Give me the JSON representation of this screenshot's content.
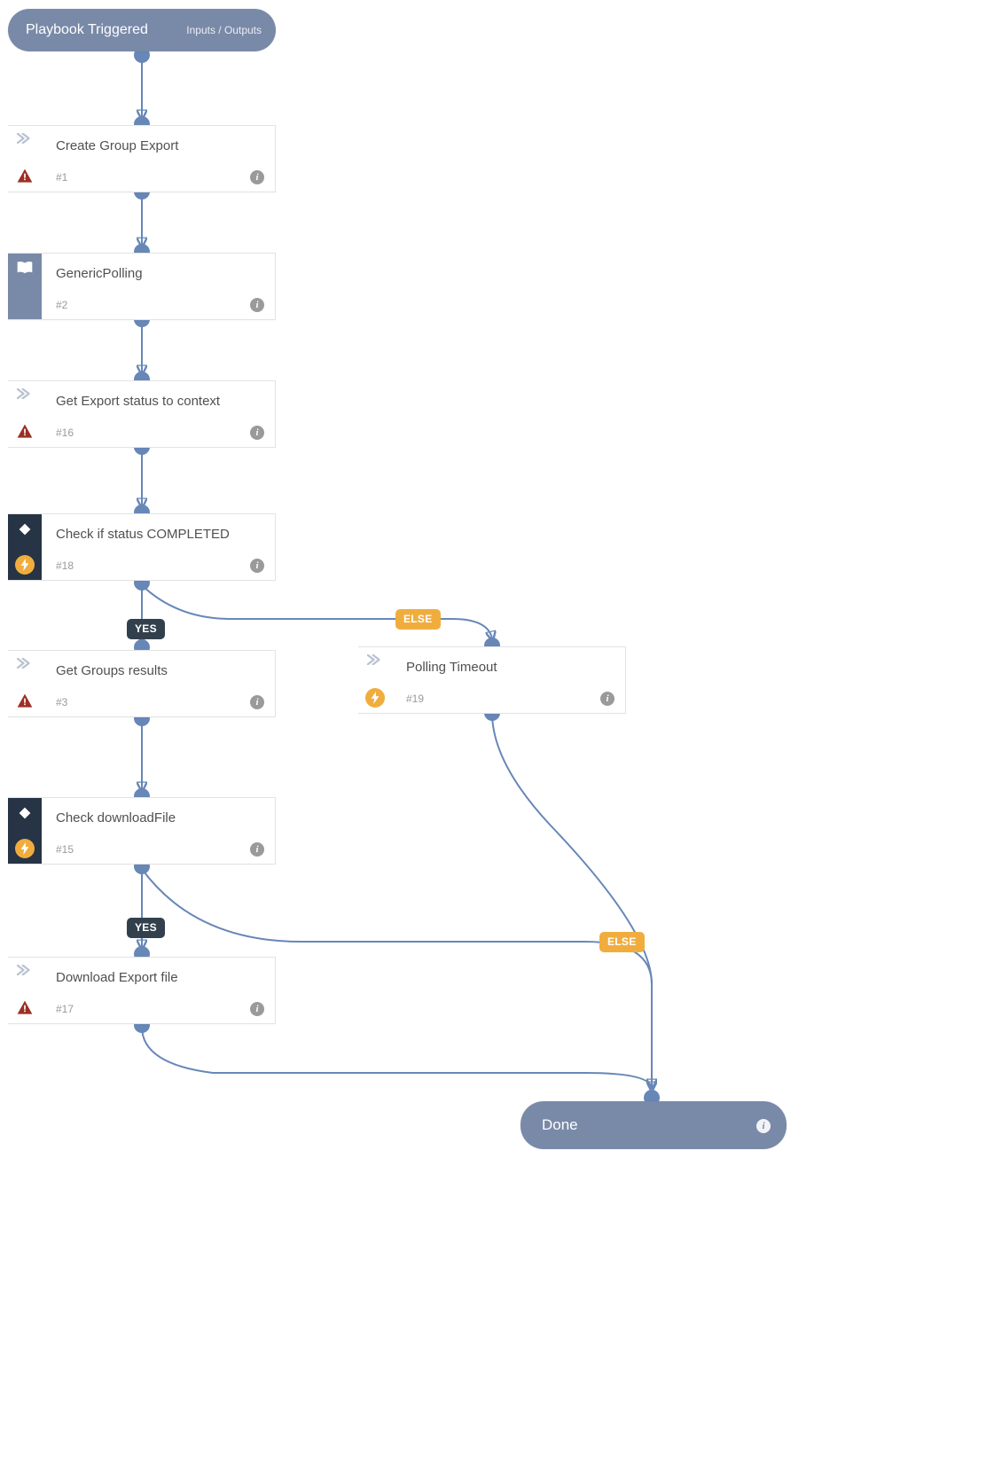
{
  "trigger": {
    "title": "Playbook Triggered",
    "io_label": "Inputs / Outputs"
  },
  "done": {
    "title": "Done"
  },
  "nodes": {
    "n1": {
      "title": "Create Group Export",
      "num": "#1"
    },
    "n2": {
      "title": "GenericPolling",
      "num": "#2"
    },
    "n16": {
      "title": "Get Export status to context",
      "num": "#16"
    },
    "n18": {
      "title": "Check if status COMPLETED",
      "num": "#18"
    },
    "n3": {
      "title": "Get Groups results",
      "num": "#3"
    },
    "n19": {
      "title": "Polling Timeout",
      "num": "#19"
    },
    "n15": {
      "title": "Check downloadFile",
      "num": "#15"
    },
    "n17": {
      "title": "Download Export file",
      "num": "#17"
    }
  },
  "branches": {
    "yes": "YES",
    "else": "ELSE"
  }
}
